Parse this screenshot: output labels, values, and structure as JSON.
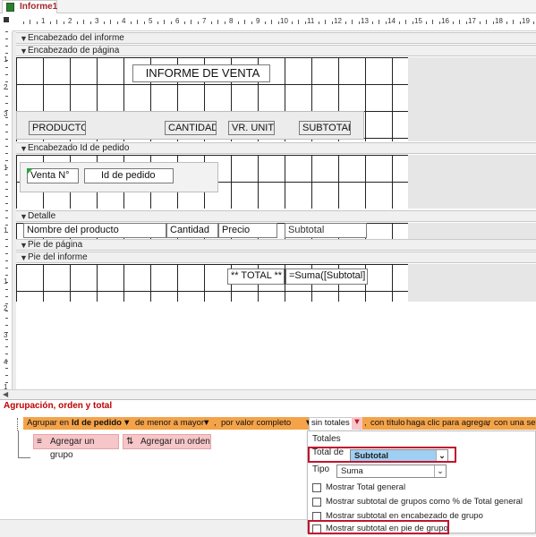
{
  "tab": {
    "label": "Informe1",
    "icon": "report-icon"
  },
  "sections": {
    "report_header": "Encabezado del informe",
    "page_header": "Encabezado de página",
    "group_header": "Encabezado Id de pedido",
    "detail": "Detalle",
    "page_footer": "Pie de página",
    "report_footer": "Pie del informe"
  },
  "ruler": {
    "numbers": [
      "1",
      "2",
      "3",
      "4",
      "5",
      "6",
      "7",
      "8",
      "9",
      "10",
      "11",
      "12",
      "13",
      "14",
      "15",
      "16",
      "17",
      "18",
      "19"
    ],
    "left_numbers": [
      "1",
      "2",
      "3",
      "1",
      "1",
      "1",
      "2",
      "3",
      "4",
      "1"
    ]
  },
  "controls": {
    "title": "INFORME DE VENTA",
    "producto": "PRODUCTO",
    "cantidad_hdr": "CANTIDAD",
    "vr_unit": "VR. UNIT.",
    "subtotal_hdr": "SUBTOTAL",
    "venta_no": "Venta N°",
    "id_pedido": "Id de pedido",
    "nombre_producto": "Nombre del producto",
    "cantidad": "Cantidad",
    "precio": "Precio",
    "subtotal": "Subtotal",
    "total_label": "** TOTAL **",
    "total_expr": "=Suma([Subtotal]"
  },
  "grouping": {
    "title": "Agrupación, orden y total",
    "row": {
      "group_on": "Agrupar en",
      "field": "Id de pedido",
      "order": "de menor a mayor",
      "sep1": ",",
      "by": "por valor completo",
      "sep2": ",",
      "totals": "sin totales",
      "sep3": ",",
      "with_title": "con título",
      "click_add": "haga clic para agregar",
      "sep4": ",",
      "header_section": "con una sec"
    },
    "add_group": "Agregar un grupo",
    "add_sort": "Agregar un orden",
    "popup": {
      "heading": "Totales",
      "total_of_label": "Total de",
      "total_of_value": "Subtotal",
      "type_label": "Tipo",
      "type_value": "Suma",
      "options": [
        "Mostrar Total general",
        "Mostrar subtotal de grupos como % de Total general",
        "Mostrar subtotal en encabezado de grupo",
        "Mostrar subtotal en pie de grupo"
      ]
    }
  },
  "colors": {
    "accent_red": "#c0152f",
    "group_bar": "#f4a349",
    "highlight_blue": "#9fd0f3"
  }
}
